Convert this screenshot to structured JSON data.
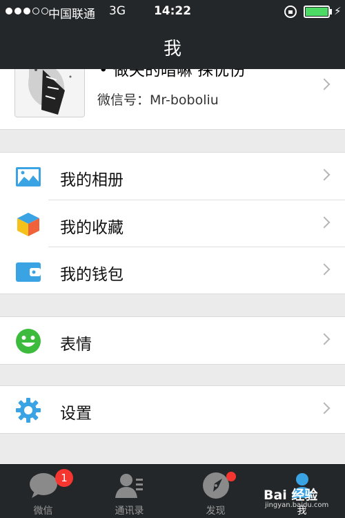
{
  "status_bar": {
    "carrier": "中国联通",
    "network": "3G",
    "time": "14:22"
  },
  "nav": {
    "title": "我"
  },
  "profile": {
    "name": "• 做失的暗嘛 探优伤",
    "wechat_id_label": "微信号：",
    "wechat_id": "Mr-boboliu"
  },
  "menu": {
    "album": {
      "label": "我的相册",
      "icon": "photo-album-icon",
      "color": "#3aa3e3"
    },
    "favorites": {
      "label": "我的收藏",
      "icon": "cube-icon"
    },
    "wallet": {
      "label": "我的钱包",
      "icon": "wallet-icon",
      "color": "#3aa3e3"
    },
    "stickers": {
      "label": "表情",
      "icon": "smiley-icon",
      "color": "#3dbb3d"
    },
    "settings": {
      "label": "设置",
      "icon": "gear-icon",
      "color": "#3aa3e3"
    }
  },
  "tab_bar": {
    "tabs": [
      {
        "label": "微信",
        "badge": "1",
        "icon": "chat-bubble-icon"
      },
      {
        "label": "通讯录",
        "icon": "contacts-icon"
      },
      {
        "label": "发现",
        "icon": "compass-icon"
      },
      {
        "label": "我",
        "icon": "person-icon",
        "active": true
      }
    ]
  },
  "watermark": {
    "brand": "Bai 经验",
    "url": "jingyan.baidu.com"
  }
}
